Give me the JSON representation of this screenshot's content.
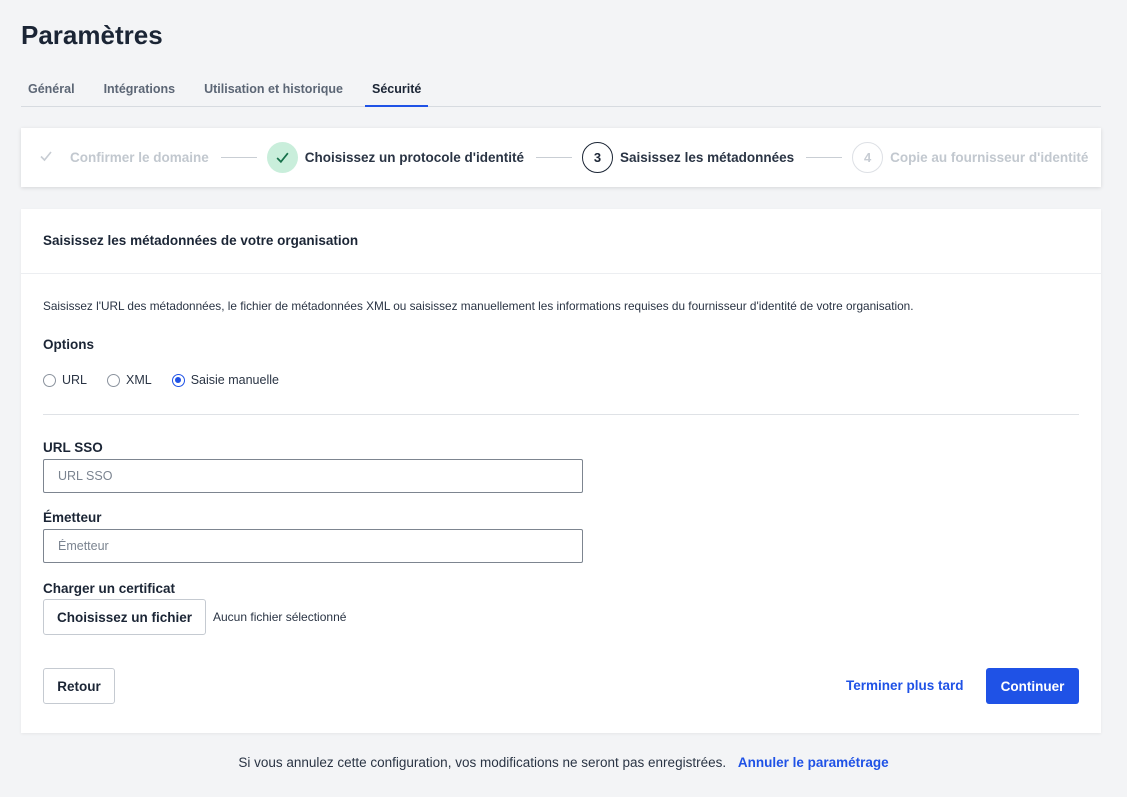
{
  "page": {
    "title": "Paramètres"
  },
  "tabs": [
    {
      "label": "Général"
    },
    {
      "label": "Intégrations"
    },
    {
      "label": "Utilisation et historique"
    },
    {
      "label": "Sécurité",
      "active": true
    }
  ],
  "stepper": {
    "steps": [
      {
        "number": "",
        "label": "Confirmer le domaine",
        "state": "completed",
        "icon": "check-icon"
      },
      {
        "number": "",
        "label": "Choisissez un protocole d'identité",
        "state": "completed",
        "icon": "check-icon"
      },
      {
        "number": "3",
        "label": "Saisissez les métadonnées",
        "state": "current"
      },
      {
        "number": "4",
        "label": "Copie au fournisseur d'identité",
        "state": "upcoming"
      }
    ]
  },
  "card": {
    "title": "Saisissez les métadonnées de votre organisation",
    "description": "Saisissez l'URL des métadonnées, le fichier de métadonnées XML ou saisissez manuellement les informations requises du fournisseur d'identité de votre organisation.",
    "options_label": "Options",
    "options": [
      {
        "label": "URL",
        "checked": false
      },
      {
        "label": "XML",
        "checked": false
      },
      {
        "label": "Saisie manuelle",
        "checked": true
      }
    ],
    "sso_url": {
      "label": "URL SSO",
      "value": "",
      "placeholder": "URL SSO"
    },
    "issuer": {
      "label": "Émetteur",
      "value": "",
      "placeholder": "Émetteur"
    },
    "certificate": {
      "label": "Charger un certificat",
      "button_label": "Choisissez un fichier",
      "status": "Aucun fichier sélectionné"
    },
    "actions": {
      "back": "Retour",
      "later": "Terminer plus tard",
      "continue": "Continuer"
    }
  },
  "footer": {
    "text": "Si vous annulez cette configuration, vos modifications ne seront pas enregistrées.",
    "link": "Annuler le paramétrage"
  },
  "colors": {
    "accent": "#1f52e6",
    "completed_bg": "#c9eedb",
    "completed_fg": "#16704a",
    "background": "#f3f4f6"
  }
}
